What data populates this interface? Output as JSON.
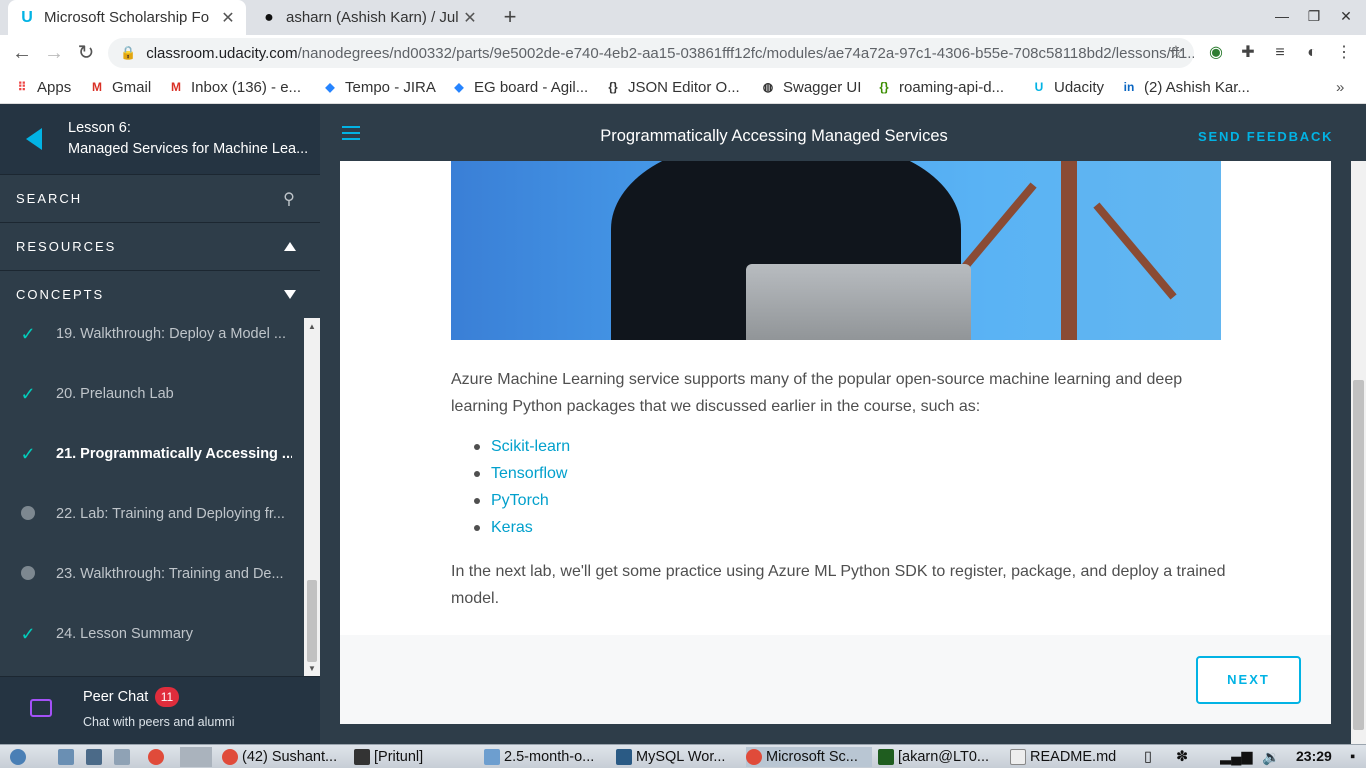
{
  "browser": {
    "tabs": [
      {
        "title": "Microsoft Scholarship Fo",
        "active": true
      },
      {
        "title": "asharn (Ashish Karn) / Jul",
        "active": false
      }
    ],
    "url_host": "classroom.udacity.com",
    "url_path": "/nanodegrees/nd00332/parts/9e5002de-e740-4eb2-aa15-03861fff12fc/modules/ae74a72a-97c1-4306-b55e-708c58118bd2/lessons/ff1...",
    "bookmarks": [
      {
        "label": "Apps",
        "icon": "apps-grid-icon"
      },
      {
        "label": "Gmail",
        "icon": "gmail-icon"
      },
      {
        "label": "Inbox (136) - e...",
        "icon": "gmail-icon"
      },
      {
        "label": "Tempo - JIRA",
        "icon": "jira-icon"
      },
      {
        "label": "EG board - Agil...",
        "icon": "jira-icon"
      },
      {
        "label": "JSON Editor O...",
        "icon": "json-editor-icon"
      },
      {
        "label": "Swagger UI",
        "icon": "swagger-icon"
      },
      {
        "label": "roaming-api-d...",
        "icon": "roaming-icon"
      },
      {
        "label": "Udacity",
        "icon": "udacity-icon"
      },
      {
        "label": "(2) Ashish Kar...",
        "icon": "linkedin-icon"
      }
    ]
  },
  "sidebar": {
    "lesson_label": "Lesson 6:",
    "lesson_title": "Managed Services for Machine Lea...",
    "search_label": "SEARCH",
    "resources_label": "RESOURCES",
    "concepts_label": "CONCEPTS",
    "concepts": [
      {
        "label": "19. Walkthrough: Deploy a Model ...",
        "status": "done"
      },
      {
        "label": "20. Prelaunch Lab",
        "status": "done"
      },
      {
        "label": "21. Programmatically Accessing ...",
        "status": "current"
      },
      {
        "label": "22. Lab: Training and Deploying fr...",
        "status": "todo"
      },
      {
        "label": "23. Walkthrough: Training and De...",
        "status": "todo"
      },
      {
        "label": "24. Lesson Summary",
        "status": "done"
      }
    ],
    "peer_chat": {
      "title": "Peer Chat",
      "badge": "11",
      "subtitle": "Chat with peers and alumni"
    }
  },
  "header": {
    "title": "Programmatically Accessing Managed Services",
    "feedback_label": "SEND FEEDBACK"
  },
  "content": {
    "paragraph1": "Azure Machine Learning service supports many of the popular open-source machine learning and deep learning Python packages that we discussed earlier in the course, such as:",
    "packages": [
      "Scikit-learn",
      "Tensorflow",
      "PyTorch",
      "Keras"
    ],
    "paragraph2": "In the next lab, we'll get some practice using Azure ML Python SDK to register, package, and deploy a trained model.",
    "next_label": "NEXT"
  },
  "taskbar": {
    "items": [
      "(42) Sushant...",
      "[Pritunl]",
      "2.5-month-o...",
      "MySQL Wor...",
      "Microsoft Sc...",
      "[akarn@LT0...",
      "README.md"
    ],
    "clock": "23:29"
  },
  "colors": {
    "accent": "#02b3e4",
    "sidebar_bg": "#2e3d49",
    "check": "#02ccba",
    "badge": "#e02d3c"
  }
}
